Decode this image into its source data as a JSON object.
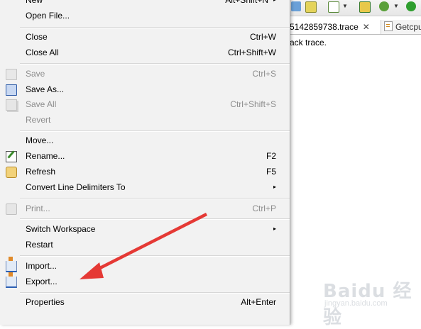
{
  "editor": {
    "active_tab_title": "5142859738.trace",
    "active_tab_close": "✕",
    "inactive_tab_title": "Getcpu",
    "content_text": "ack trace."
  },
  "menu": {
    "items": [
      {
        "label": "New",
        "accel": "Alt+Shift+N",
        "has_submenu": true,
        "enabled": true,
        "icon": ""
      },
      {
        "label": "Open File...",
        "accel": "",
        "enabled": true,
        "icon": ""
      },
      {
        "label": "Close",
        "accel": "Ctrl+W",
        "enabled": true,
        "icon": ""
      },
      {
        "label": "Close All",
        "accel": "Ctrl+Shift+W",
        "enabled": true,
        "icon": ""
      },
      {
        "label": "Save",
        "accel": "Ctrl+S",
        "enabled": false,
        "icon": "save-icon"
      },
      {
        "label": "Save As...",
        "accel": "",
        "enabled": true,
        "icon": "save-as-icon"
      },
      {
        "label": "Save All",
        "accel": "Ctrl+Shift+S",
        "enabled": false,
        "icon": "save-all-icon"
      },
      {
        "label": "Revert",
        "accel": "",
        "enabled": false,
        "icon": ""
      },
      {
        "label": "Move...",
        "accel": "",
        "enabled": true,
        "icon": ""
      },
      {
        "label": "Rename...",
        "accel": "F2",
        "enabled": true,
        "icon": "rename-icon"
      },
      {
        "label": "Refresh",
        "accel": "F5",
        "enabled": true,
        "icon": "refresh-icon"
      },
      {
        "label": "Convert Line Delimiters To",
        "accel": "",
        "has_submenu": true,
        "enabled": true,
        "icon": ""
      },
      {
        "label": "Print...",
        "accel": "Ctrl+P",
        "enabled": false,
        "icon": "print-icon"
      },
      {
        "label": "Switch Workspace",
        "accel": "",
        "has_submenu": true,
        "enabled": true,
        "icon": ""
      },
      {
        "label": "Restart",
        "accel": "",
        "enabled": true,
        "icon": ""
      },
      {
        "label": "Import...",
        "accel": "",
        "enabled": true,
        "icon": "import-icon"
      },
      {
        "label": "Export...",
        "accel": "",
        "enabled": true,
        "icon": "export-icon"
      },
      {
        "label": "Properties",
        "accel": "Alt+Enter",
        "enabled": true,
        "icon": ""
      }
    ],
    "submenu_glyph": "▸"
  },
  "watermark": {
    "main": "Baidu 经验",
    "sub": "jingyan.baidu.com"
  },
  "colors": {
    "annotation_red": "#e53935",
    "menu_bg": "#f2f2f2",
    "disabled_text": "#8d8d8d"
  }
}
